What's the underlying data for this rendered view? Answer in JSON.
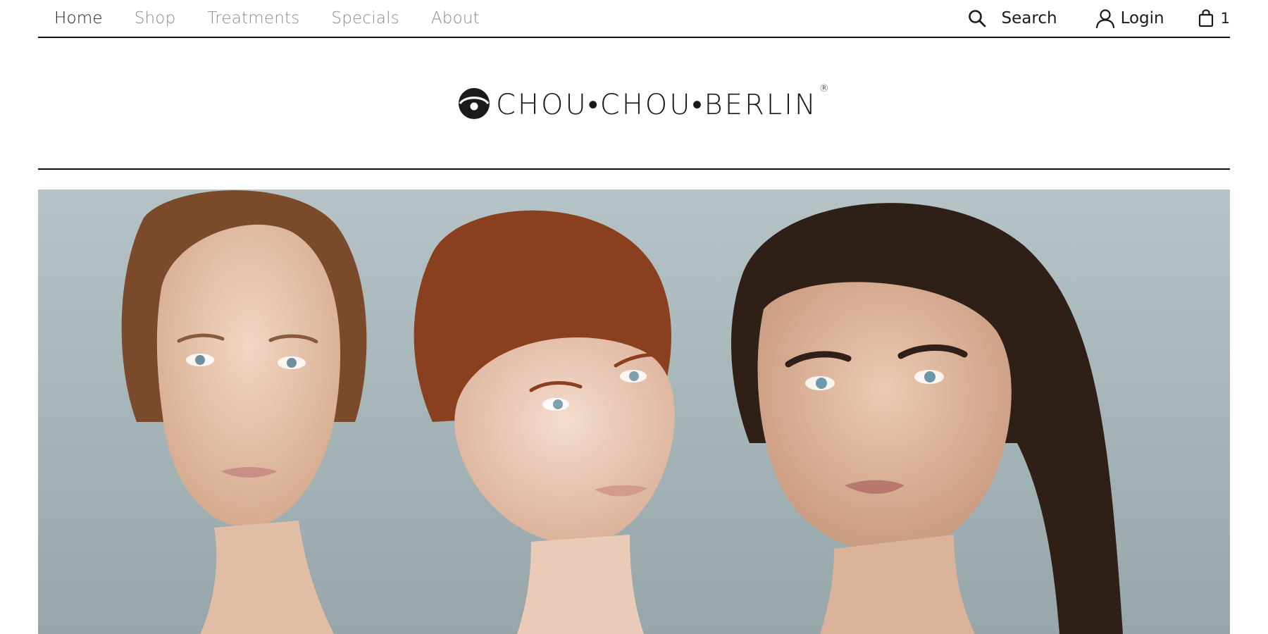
{
  "nav": {
    "links": [
      {
        "label": "Home",
        "state": "active"
      },
      {
        "label": "Shop",
        "state": "muted"
      },
      {
        "label": "Treatments",
        "state": "muted"
      },
      {
        "label": "Specials",
        "state": "muted"
      },
      {
        "label": "About",
        "state": "muted"
      }
    ],
    "search_label": "Search",
    "login_label": "Login",
    "cart_count": "1"
  },
  "logo": {
    "text": "CHOU•CHOU•BERLIN",
    "registered": "®"
  },
  "hero": {
    "description_icon": "hero-photo",
    "colors": {
      "backdrop": "#a9b8bb",
      "skin": "#e9c6ad",
      "hair_left": "#7a4a2a",
      "hair_middle": "#8a3f1e",
      "hair_right": "#2e1f17"
    }
  },
  "colors": {
    "text": "#1a1a1a",
    "muted": "#8a8a8a",
    "rule": "#111111",
    "background": "#ffffff"
  }
}
